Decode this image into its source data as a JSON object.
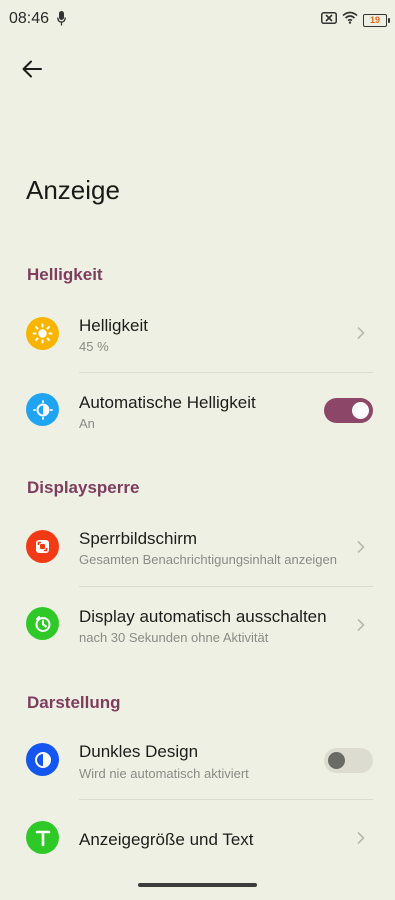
{
  "status_bar": {
    "time": "08:46",
    "battery_level": "19",
    "icons": [
      "mic-icon",
      "sim-off-icon",
      "wifi-icon",
      "battery-icon"
    ]
  },
  "header": {
    "back_icon": "arrow-left-icon",
    "title": "Anzeige"
  },
  "sections": [
    {
      "label": "Helligkeit",
      "items": [
        {
          "title": "Helligkeit",
          "subtitle": "45 %",
          "icon": "sun-icon",
          "icon_color": "#f7b500",
          "control": "chevron"
        },
        {
          "title": "Automatische Helligkeit",
          "subtitle": "An",
          "icon": "auto-brightness-icon",
          "icon_color": "#1fa4f2",
          "control": "toggle",
          "toggle_on": true
        }
      ]
    },
    {
      "label": "Displaysperre",
      "items": [
        {
          "title": "Sperrbildschirm",
          "subtitle": "Gesamten Benachrichtigungsinhalt anzeigen",
          "icon": "lock-screen-icon",
          "icon_color": "#f23a15",
          "control": "chevron"
        },
        {
          "title": "Display automatisch ausschalten",
          "subtitle": "nach 30 Sekunden ohne Aktivität",
          "icon": "timer-icon",
          "icon_color": "#2ec927",
          "control": "chevron"
        }
      ]
    },
    {
      "label": "Darstellung",
      "items": [
        {
          "title": "Dunkles Design",
          "subtitle": "Wird nie automatisch aktiviert",
          "icon": "dark-mode-icon",
          "icon_color": "#1357f0",
          "control": "toggle",
          "toggle_on": false
        },
        {
          "title": "Anzeigegröße und Text",
          "icon": "text-size-icon",
          "icon_color": "#2ec927",
          "control": "chevron"
        }
      ]
    }
  ],
  "colors": {
    "background": "#eff0e4",
    "accent": "#7e3d5e",
    "toggle_on": "#8b4668"
  }
}
